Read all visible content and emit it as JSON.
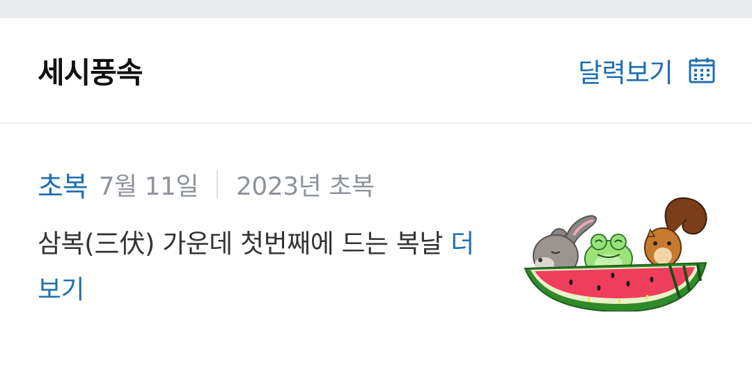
{
  "header": {
    "title": "세시풍속",
    "calendar_link": "달력보기",
    "calendar_icon": "calendar-icon"
  },
  "event": {
    "name": "초복",
    "date": "7월 11일",
    "year_label": "2023년 초복",
    "description": "삼복(三伏) 가운데 첫번째에 드는 복날",
    "more_link": "더보기",
    "illustration": "rabbit-frog-squirrel-watermelon-illustration"
  },
  "colors": {
    "accent": "#1f6fb2",
    "title": "#111111",
    "muted": "#8d9399",
    "body_text": "#333333",
    "top_band": "#e9ecef"
  }
}
